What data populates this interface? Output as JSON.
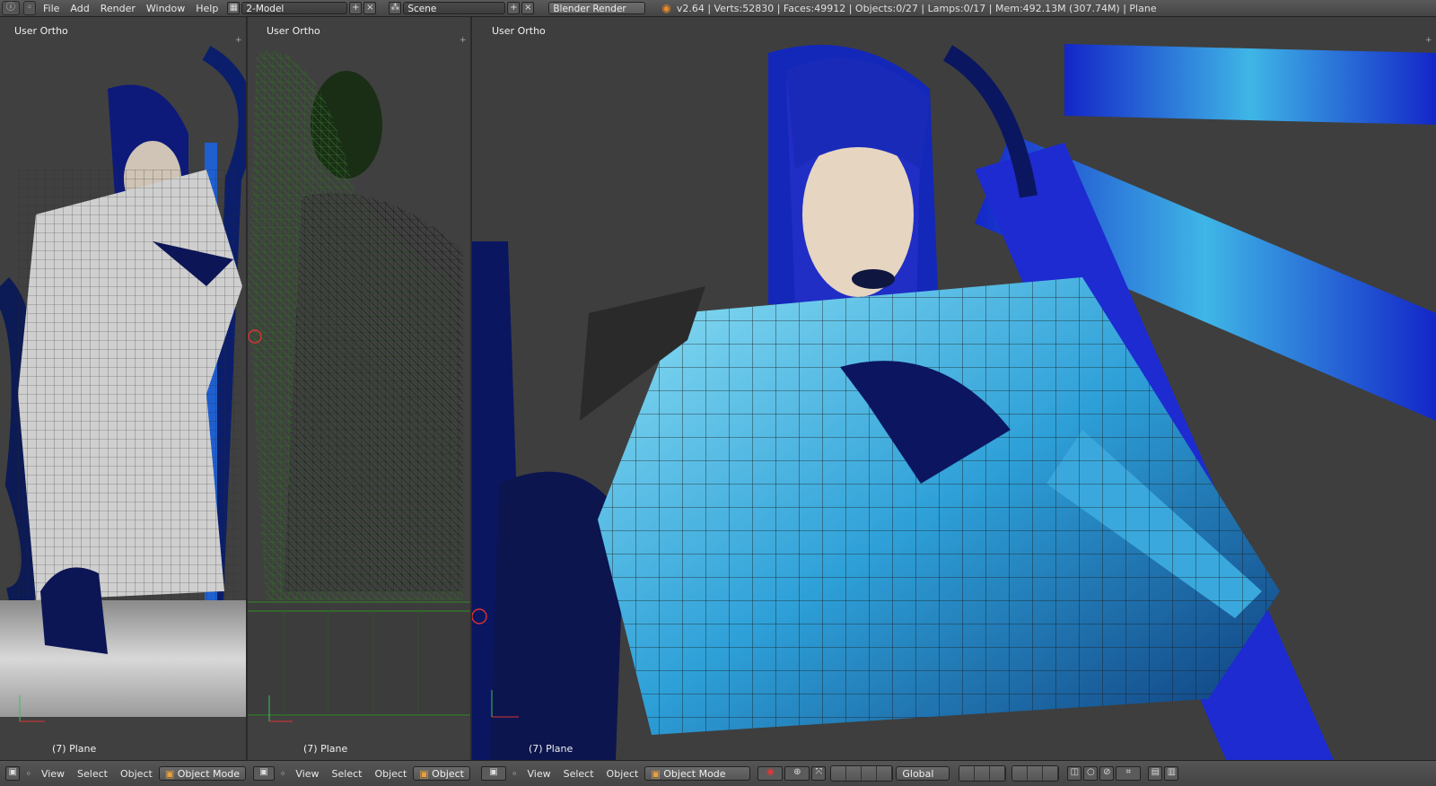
{
  "topbar": {
    "menus": [
      "File",
      "Add",
      "Render",
      "Window",
      "Help"
    ],
    "screen_layout": "2-Model",
    "scene": "Scene",
    "render_engine": "Blender Render",
    "status": "v2.64 | Verts:52830 | Faces:49912 | Objects:0/27 | Lamps:0/17 | Mem:492.13M (307.74M) | Plane"
  },
  "viewports": [
    {
      "title": "User Ortho",
      "object": "(7) Plane"
    },
    {
      "title": "User Ortho",
      "object": "(7) Plane"
    },
    {
      "title": "User Ortho",
      "object": "(7) Plane"
    }
  ],
  "bottombars": [
    {
      "menus": [
        "View",
        "Select",
        "Object"
      ],
      "mode": "Object Mode"
    },
    {
      "menus": [
        "View",
        "Select",
        "Object"
      ],
      "mode": "Object"
    },
    {
      "menus": [
        "View",
        "Select",
        "Object"
      ],
      "mode": "Object Mode",
      "orientation": "Global"
    }
  ],
  "colors": {
    "accent_blue": "#1f2fd0",
    "cyan": "#3fb6e6",
    "wire_green": "#2f6b24"
  }
}
